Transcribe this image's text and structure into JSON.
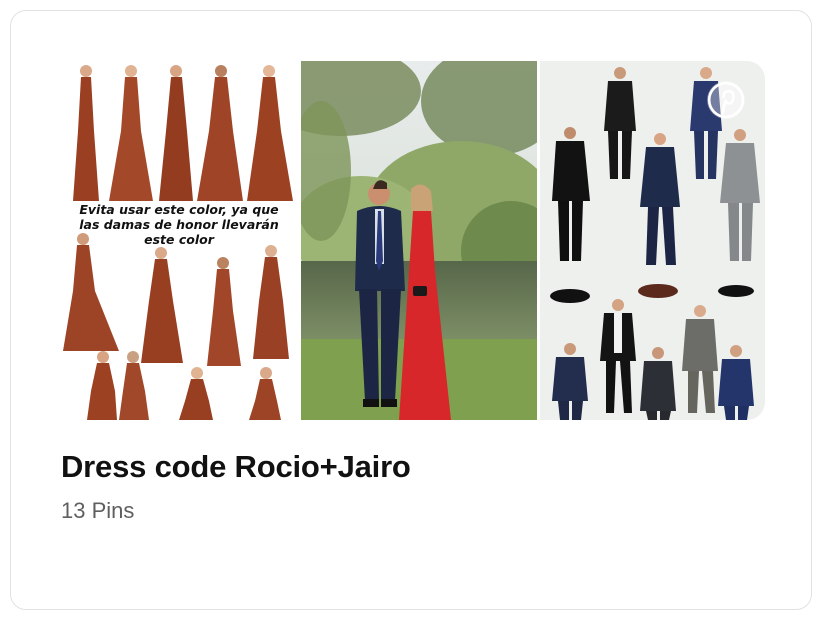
{
  "board": {
    "title": "Dress code Rocio+Jairo",
    "pin_count": "13 Pins"
  },
  "collage": {
    "left_image_caption": "Evita usar este color, ya que las damas de honor llevarán este color",
    "left_image_caption_lines": [
      "Evita usar este color, ya que",
      "las damas de honor llevarán",
      "este color"
    ]
  },
  "colors": {
    "dress": "#9a3f22",
    "red_dress": "#d8272a",
    "navy_suit": "#1f2b4a",
    "title_text": "#111111",
    "subtitle_text": "#5f5f5f"
  },
  "icons": {
    "pinterest_badge": "pinterest-icon"
  }
}
